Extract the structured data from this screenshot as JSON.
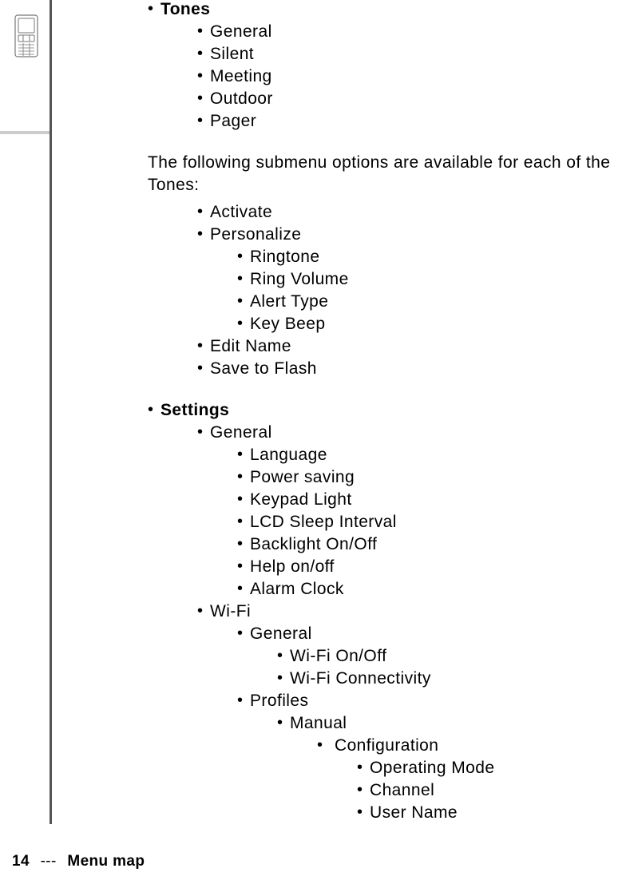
{
  "sections": {
    "tones": {
      "title": "Tones",
      "items": [
        "General",
        "Silent",
        "Meeting",
        "Outdoor",
        "Pager"
      ],
      "note": "The following submenu options are available for each of the Tones:",
      "submenu": {
        "activate": "Activate",
        "personalize": {
          "label": "Personalize",
          "items": [
            "Ringtone",
            "Ring Volume",
            "Alert Type",
            "Key Beep"
          ]
        },
        "edit_name": "Edit Name",
        "save_to_flash": "Save to Flash"
      }
    },
    "settings": {
      "title": "Settings",
      "general": {
        "label": "General",
        "items": [
          "Language",
          "Power saving",
          "Keypad Light",
          "LCD Sleep Interval",
          "Backlight On/Off",
          "Help on/off",
          "Alarm Clock"
        ]
      },
      "wifi": {
        "label": "Wi-Fi",
        "general": {
          "label": "General",
          "items": [
            "Wi-Fi On/Off",
            "Wi-Fi Connectivity"
          ]
        },
        "profiles": {
          "label": "Profiles",
          "manual": {
            "label": "Manual",
            "configuration": {
              "label": "Configuration",
              "items": [
                "Operating Mode",
                "Channel",
                "User Name"
              ]
            }
          }
        }
      }
    }
  },
  "footer": {
    "page": "14",
    "sep": "---",
    "title": "Menu map"
  }
}
